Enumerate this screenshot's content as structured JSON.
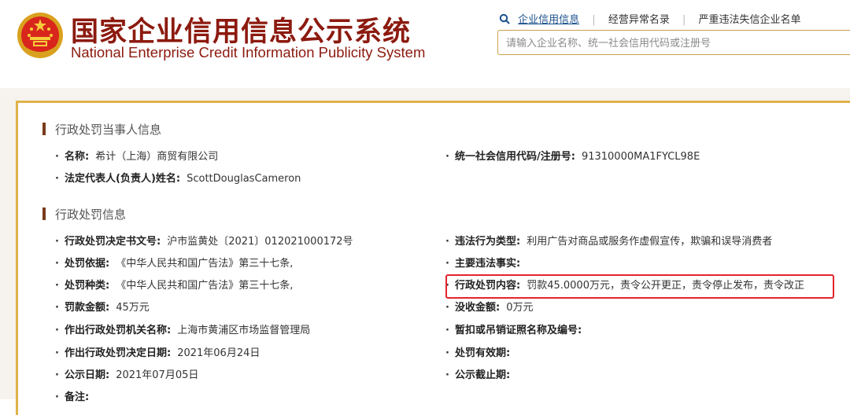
{
  "header": {
    "title_cn": "国家企业信用信息公示系统",
    "title_en": "National Enterprise Credit Information Publicity System",
    "emblem_icon": "national-emblem-icon",
    "nav": [
      {
        "label": "企业信用信息",
        "active": true
      },
      {
        "label": "经营异常名录",
        "active": false
      },
      {
        "label": "严重违法失信企业名单",
        "active": false
      }
    ],
    "search_placeholder": "请输入企业名称、统一社会信用代码或注册号"
  },
  "colors": {
    "brand_red": "#8c1a0f",
    "panel_border": "#e0b24a",
    "highlight_red": "#e3242b",
    "link_blue": "#1a4f8b"
  },
  "party_section": {
    "title": "行政处罚当事人信息",
    "rows": [
      {
        "label": "名称:",
        "value": "希计（上海）商贸有限公司"
      },
      {
        "label": "统一社会信用代码/注册号:",
        "value": "91310000MA1FYCL98E"
      },
      {
        "label": "法定代表人(负责人)姓名:",
        "value": "ScottDouglasCameron"
      }
    ]
  },
  "penalty_section": {
    "title": "行政处罚信息",
    "left": [
      {
        "label": "行政处罚决定书文号:",
        "value": "沪市监黄处〔2021〕012021000172号"
      },
      {
        "label": "处罚依据:",
        "value": "《中华人民共和国广告法》第三十七条,"
      },
      {
        "label": "处罚种类:",
        "value": "《中华人民共和国广告法》第三十七条,"
      },
      {
        "label": "罚款金额:",
        "value": "45万元"
      },
      {
        "label": "作出行政处罚机关名称:",
        "value": "上海市黄浦区市场监督管理局"
      },
      {
        "label": "作出行政处罚决定日期:",
        "value": "2021年06月24日"
      },
      {
        "label": "公示日期:",
        "value": "2021年07月05日"
      },
      {
        "label": "备注:",
        "value": ""
      }
    ],
    "right": [
      {
        "label": "违法行为类型:",
        "value": "利用广告对商品或服务作虚假宣传，欺骗和误导消费者"
      },
      {
        "label": "主要违法事实:",
        "value": ""
      },
      {
        "label": "行政处罚内容:",
        "value": "罚款45.0000万元，责令公开更正，责令停止发布，责令改正"
      },
      {
        "label": "没收金额:",
        "value": "0万元"
      },
      {
        "label": "暂扣或吊销证照名称及编号:",
        "value": ""
      },
      {
        "label": "处罚有效期:",
        "value": ""
      },
      {
        "label": "公示截止期:",
        "value": ""
      }
    ]
  }
}
